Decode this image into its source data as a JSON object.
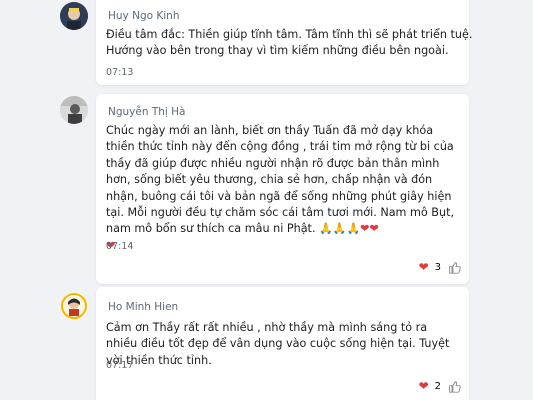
{
  "comments": [
    {
      "author": "Huy Ngo Kinh",
      "text_line1": "Điều tâm đắc: Thiền giúp tĩnh tâm. Tâm tĩnh thì sẽ phát triển tuệ.",
      "text_line2": "Hướng vào bên trong thay vì tìm kiếm những điều bên ngoài.",
      "time": "07:13"
    },
    {
      "author": "Nguyễn Thị Hà",
      "text": "Chúc ngày mới an lành, biết ơn thầy Tuấn đã mở dạy khóa thiền thức tỉnh này đến cộng đồng , trái tim mở rộng từ bi của thầy đã giúp được nhiều người nhận rõ được bản thân mình hơn, sống biết yêu thương, chia sẻ hơn, chấp nhận và đón nhận, buông cái tôi và bản ngã để sống những phút giây hiện tại. Mỗi người đều tự chăm sóc cái tâm tươi mới. Nam mô Bụt, nam mô bổn sư thích ca mâu ni Phật.",
      "emojis": "🙏🙏🙏",
      "hearts": "❤❤",
      "heart_last": "❤",
      "time": "07:14",
      "reaction_count": "3"
    },
    {
      "author": "Ho Minh Hien",
      "text": "Cảm ơn Thầy rất rất nhiều , nhờ thầy mà mình sáng tỏ ra nhiều điều tốt đẹp để vân dụng vào cuộc sống hiện tại. Tuyệt vời thiền thức tỉnh.",
      "time": "07:17",
      "reaction_count": "2"
    }
  ],
  "icons": {
    "reaction": "heart-icon",
    "like": "thumbs-up-icon"
  },
  "colors": {
    "heart": "#e0393e",
    "background": "#f0f2f5",
    "card": "#ffffff"
  }
}
